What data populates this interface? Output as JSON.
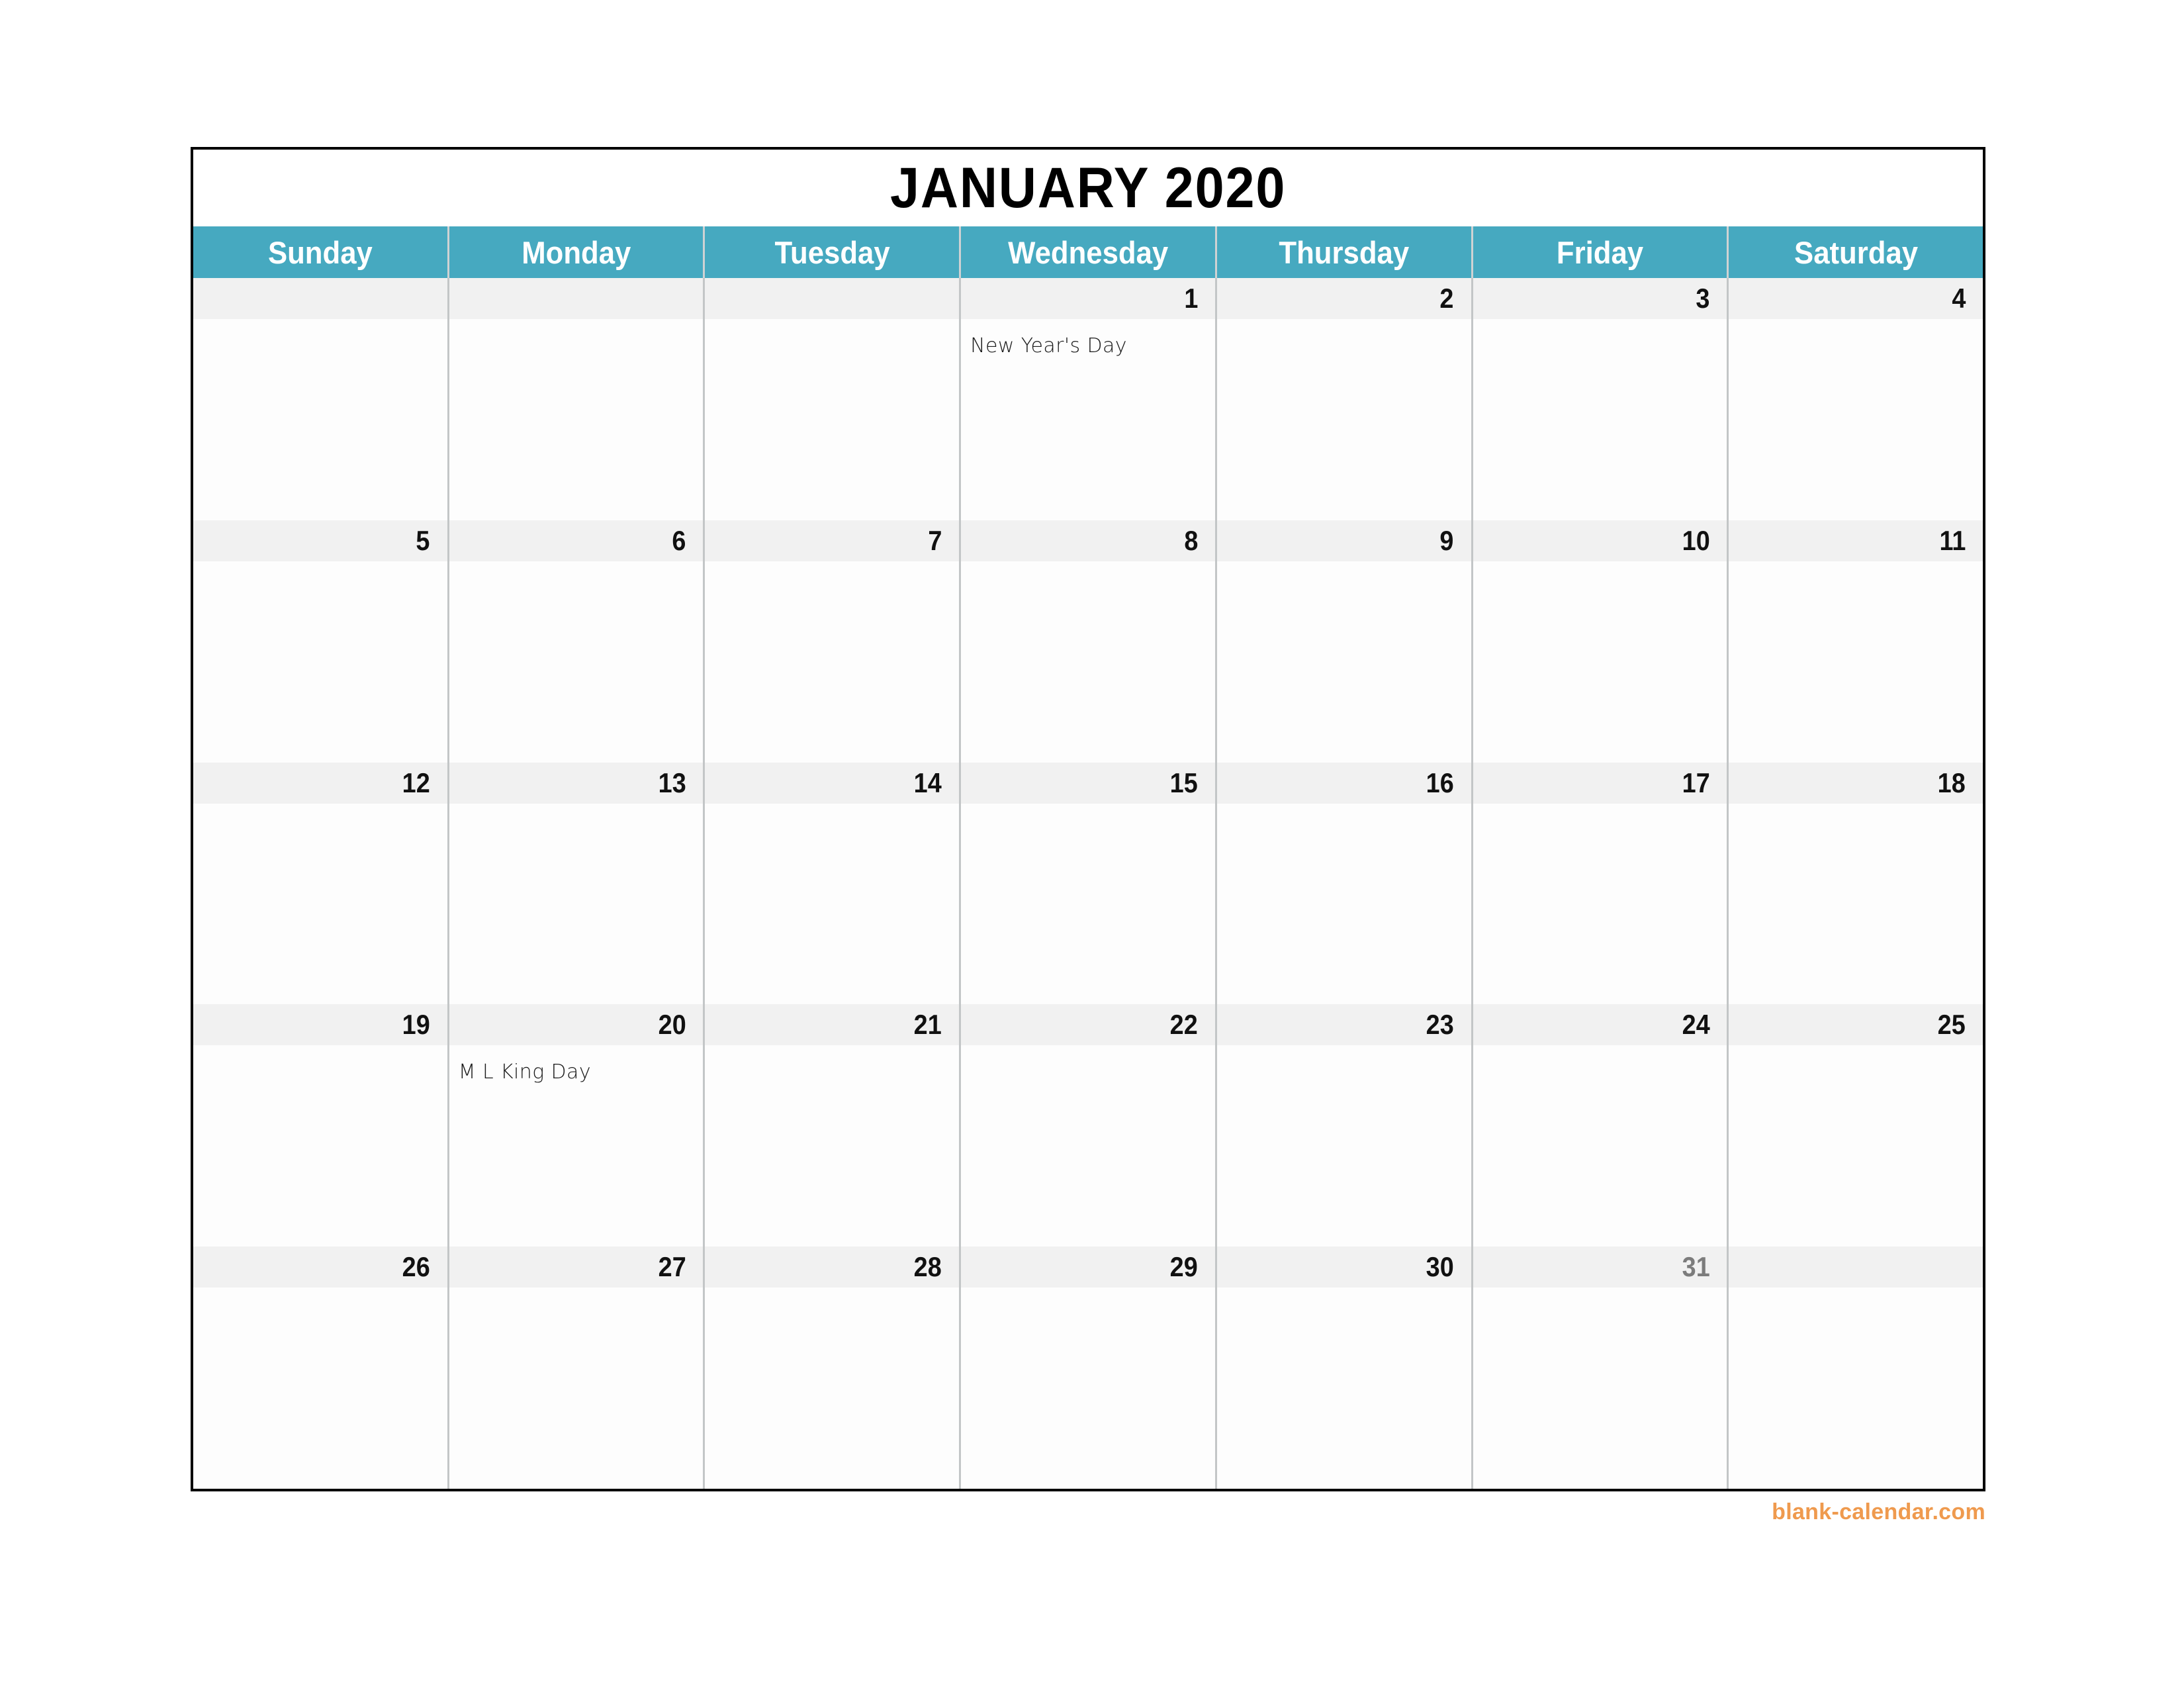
{
  "calendar": {
    "title": "JANUARY 2020",
    "month": "January",
    "year": "2020",
    "weekday_headers": [
      "Sunday",
      "Monday",
      "Tuesday",
      "Wednesday",
      "Thursday",
      "Friday",
      "Saturday"
    ],
    "weeks": [
      [
        {
          "date": "",
          "event": ""
        },
        {
          "date": "",
          "event": ""
        },
        {
          "date": "",
          "event": ""
        },
        {
          "date": "1",
          "event": "New Year's Day"
        },
        {
          "date": "2",
          "event": ""
        },
        {
          "date": "3",
          "event": ""
        },
        {
          "date": "4",
          "event": ""
        }
      ],
      [
        {
          "date": "5",
          "event": ""
        },
        {
          "date": "6",
          "event": ""
        },
        {
          "date": "7",
          "event": ""
        },
        {
          "date": "8",
          "event": ""
        },
        {
          "date": "9",
          "event": ""
        },
        {
          "date": "10",
          "event": ""
        },
        {
          "date": "11",
          "event": ""
        }
      ],
      [
        {
          "date": "12",
          "event": ""
        },
        {
          "date": "13",
          "event": ""
        },
        {
          "date": "14",
          "event": ""
        },
        {
          "date": "15",
          "event": ""
        },
        {
          "date": "16",
          "event": ""
        },
        {
          "date": "17",
          "event": ""
        },
        {
          "date": "18",
          "event": ""
        }
      ],
      [
        {
          "date": "19",
          "event": ""
        },
        {
          "date": "20",
          "event": "M L King Day"
        },
        {
          "date": "21",
          "event": ""
        },
        {
          "date": "22",
          "event": ""
        },
        {
          "date": "23",
          "event": ""
        },
        {
          "date": "24",
          "event": ""
        },
        {
          "date": "25",
          "event": ""
        }
      ],
      [
        {
          "date": "26",
          "event": ""
        },
        {
          "date": "27",
          "event": ""
        },
        {
          "date": "28",
          "event": ""
        },
        {
          "date": "29",
          "event": ""
        },
        {
          "date": "30",
          "event": ""
        },
        {
          "date": "31",
          "event": "",
          "muted": true
        },
        {
          "date": "",
          "event": ""
        }
      ]
    ],
    "footer": {
      "watermark": "blank-calendar.com"
    },
    "colors": {
      "header_band": "#46a9c0",
      "header_text": "#ffffff",
      "daynum_band": "#f1f1f1",
      "daynum_text": "#111111",
      "daynum_muted_text": "#7c7c7c",
      "cell_background": "#fdfdfd",
      "grid_line": "#c3c6c7",
      "frame_border": "#000000",
      "title_text": "#000000",
      "watermark": "#ef9a4e"
    }
  }
}
